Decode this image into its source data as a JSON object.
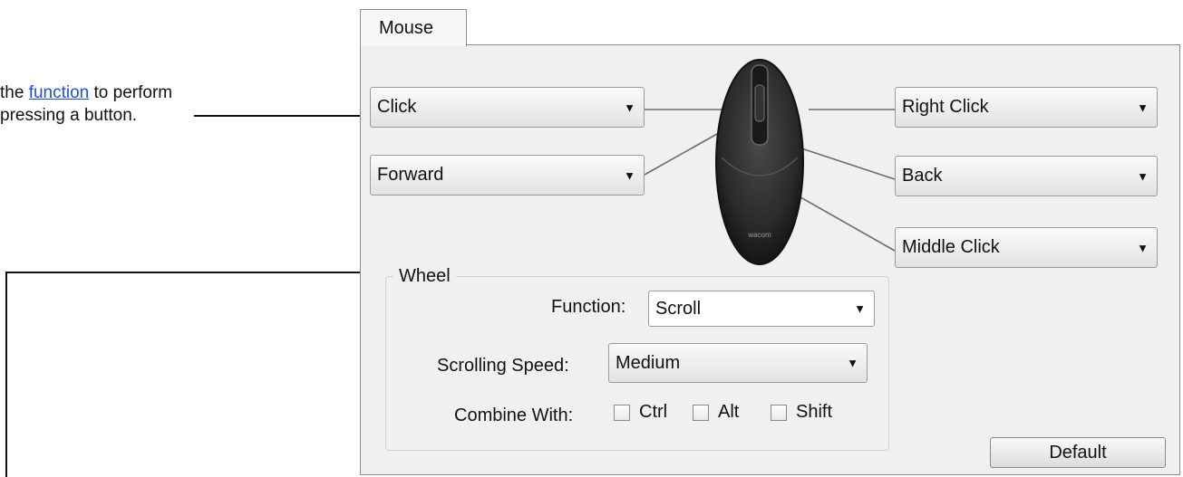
{
  "annotation": {
    "line1_prefix": "the ",
    "line1_link": "function",
    "line1_suffix": " to perform",
    "line2": "pressing a button."
  },
  "tab": {
    "label": "Mouse"
  },
  "buttons": {
    "left": "Click",
    "side": "Forward",
    "right": "Right Click",
    "back": "Back",
    "middle": "Middle Click"
  },
  "mouse": {
    "brand": "wacom"
  },
  "wheel": {
    "title": "Wheel",
    "function_label": "Function:",
    "function_value": "Scroll",
    "speed_label": "Scrolling Speed:",
    "speed_value": "Medium",
    "combine_label": "Combine With:",
    "modifiers": [
      {
        "label": "Ctrl",
        "checked": false
      },
      {
        "label": "Alt",
        "checked": false
      },
      {
        "label": "Shift",
        "checked": false
      }
    ]
  },
  "default_button": "Default",
  "icons": {
    "dropdown": "triangle-down-icon"
  }
}
